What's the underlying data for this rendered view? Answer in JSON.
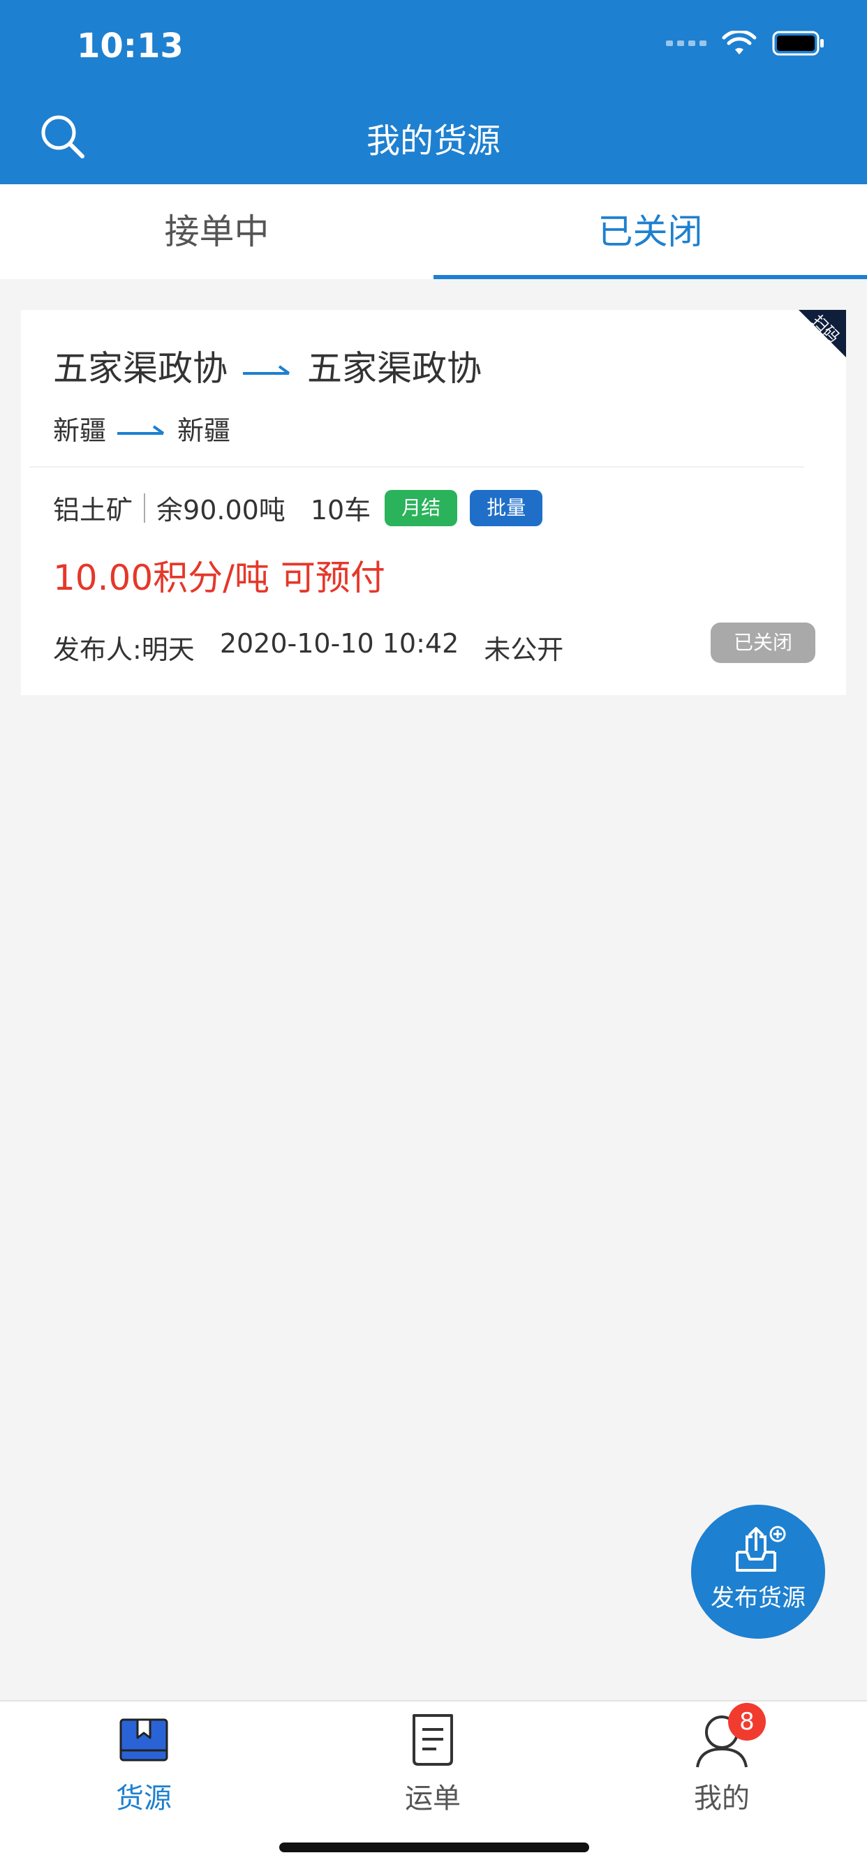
{
  "status": {
    "time": "10:13"
  },
  "header": {
    "title": "我的货源"
  },
  "tabs": [
    {
      "label": "接单中",
      "active": false
    },
    {
      "label": "已关闭",
      "active": true
    }
  ],
  "card": {
    "corner_label": "扫码",
    "from_place": "五家渠政协",
    "to_place": "五家渠政协",
    "from_region": "新疆",
    "to_region": "新疆",
    "cargo": "铝土矿",
    "remaining": "余90.00吨",
    "cars": "10车",
    "badges": [
      "月结",
      "批量"
    ],
    "price": "10.00积分/吨 可预付",
    "publisher": "发布人:明天",
    "datetime": "2020-10-10 10:42",
    "visibility": "未公开",
    "status": "已关闭"
  },
  "fab": {
    "label": "发布货源"
  },
  "bottom_nav": [
    {
      "label": "货源",
      "icon": "cargo-box-icon",
      "active": true
    },
    {
      "label": "运单",
      "icon": "document-icon",
      "active": false
    },
    {
      "label": "我的",
      "icon": "user-icon",
      "active": false,
      "badge": "8"
    }
  ],
  "colors": {
    "primary": "#1e80d0",
    "price_red": "#e5372a",
    "green_badge": "#2ab35a",
    "blue_badge": "#1f6fc9",
    "closed_gray": "#a9a9a9"
  }
}
